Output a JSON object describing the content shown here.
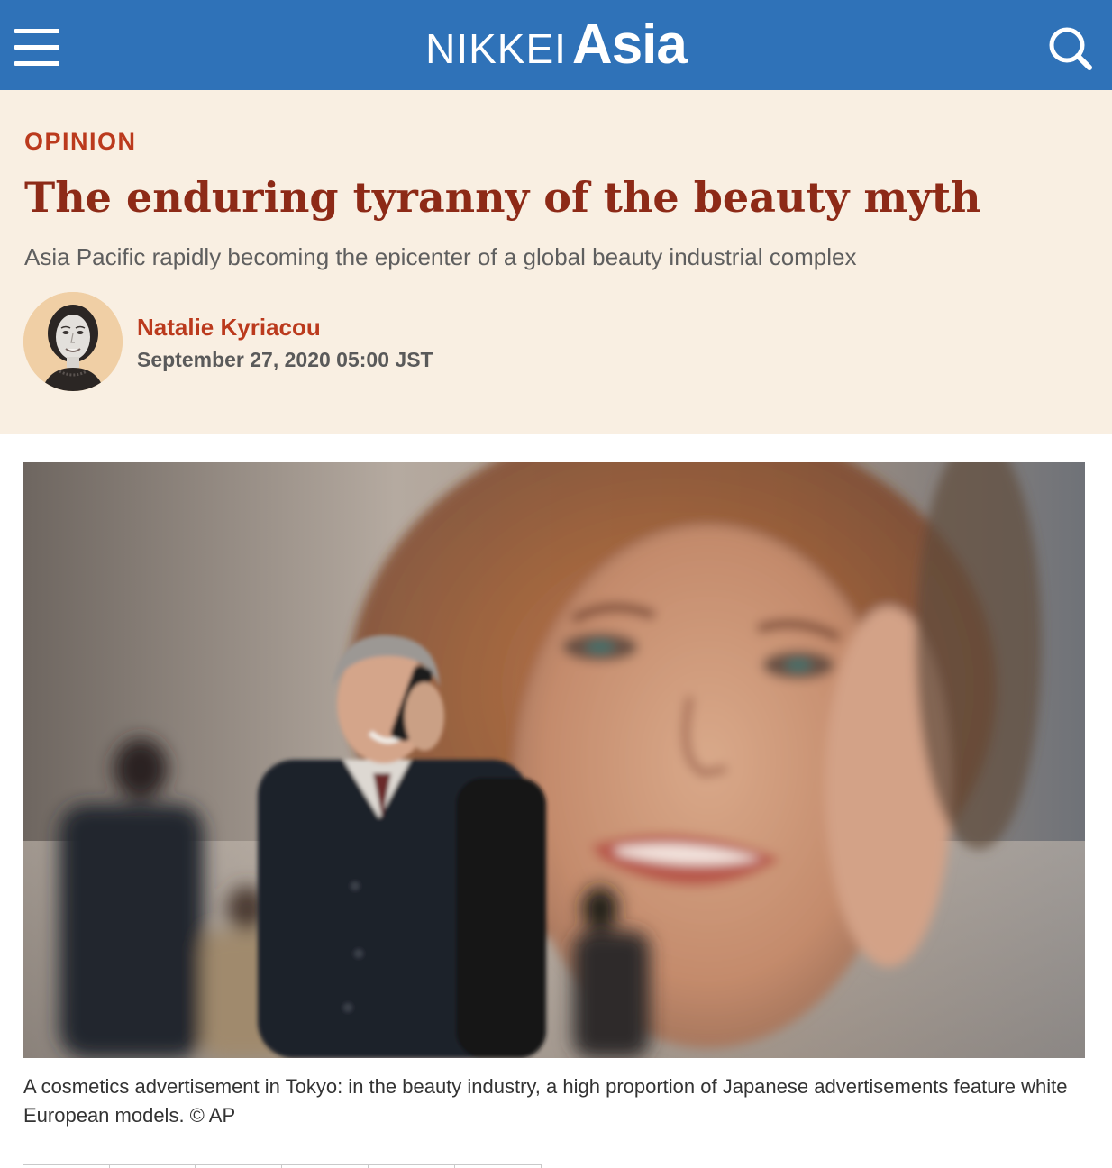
{
  "header": {
    "logo_nikkei": "NIKKEI",
    "logo_asia": "Asia",
    "menu_icon": "hamburger-menu-icon",
    "search_icon": "search-icon",
    "bar_color": "#2f72b8"
  },
  "article": {
    "section": "OPINION",
    "title": "The enduring tyranny of the beauty myth",
    "subtitle": "Asia Pacific rapidly becoming the epicenter of a global beauty industrial complex",
    "author": "Natalie Kyriacou",
    "date": "September 27, 2020 05:00 JST",
    "caption": "A cosmetics advertisement in Tokyo: in the beauty industry, a high proportion of Japanese advertisements feature white European models. © AP",
    "accent_color": "#bb3a1d",
    "title_color": "#8d2a17",
    "header_bg": "#f9efe2"
  }
}
